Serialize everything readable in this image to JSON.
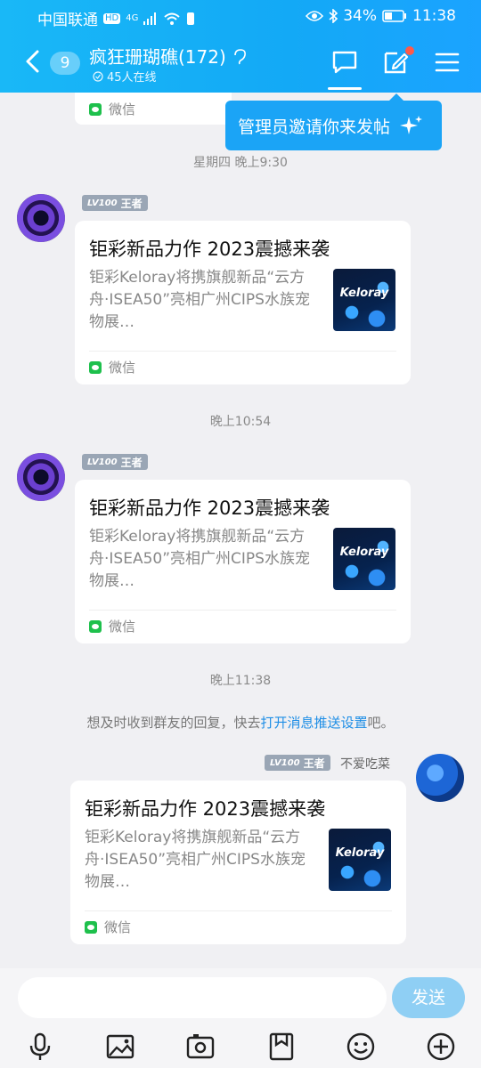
{
  "status_bar": {
    "carrier": "中国联通",
    "hd": "HD",
    "network": "4G",
    "battery_percent": "34%",
    "time": "11:38"
  },
  "header": {
    "unread_count": "9",
    "group_name": "疯狂珊瑚礁(172)",
    "online_text": "45人在线"
  },
  "tooltip": {
    "text": "管理员邀请你来发帖"
  },
  "colors": {
    "header": "#13a9f6",
    "send_button": "#8fcff4",
    "link": "#1e8ee6",
    "level_badge": "#9aa6b5"
  },
  "messages": [
    {
      "type": "partial_card",
      "source": "微信"
    },
    {
      "timestamp": "星期四 晚上9:30"
    },
    {
      "level_prefix": "LV100",
      "level_title": "王者",
      "card": {
        "title": "钜彩新品力作 2023震撼来袭",
        "description": "钜彩Keloray将携旗舰新品“云方舟·ISEA50”亮相广州CIPS水族宠物展…",
        "thumbnail_text": "Keloray",
        "source": "微信"
      }
    },
    {
      "timestamp": "晚上10:54"
    },
    {
      "level_prefix": "LV100",
      "level_title": "王者",
      "card": {
        "title": "钜彩新品力作 2023震撼来袭",
        "description": "钜彩Keloray将携旗舰新品“云方舟·ISEA50”亮相广州CIPS水族宠物展…",
        "thumbnail_text": "Keloray",
        "source": "微信"
      }
    },
    {
      "timestamp": "晚上11:38"
    },
    {
      "notice_prefix": "想及时收到群友的回复，快去",
      "notice_link": "打开消息推送设置",
      "notice_suffix": "吧。"
    },
    {
      "self": true,
      "level_prefix": "LV100",
      "level_title": "王者",
      "sender_name": "不爱吃菜",
      "card": {
        "title": "钜彩新品力作 2023震撼来袭",
        "description": "钜彩Keloray将携旗舰新品“云方舟·ISEA50”亮相广州CIPS水族宠物展…",
        "thumbnail_text": "Keloray",
        "source": "微信"
      }
    }
  ],
  "composer": {
    "send_label": "发送",
    "tools": [
      "microphone-icon",
      "image-icon",
      "camera-icon",
      "bookmark-icon",
      "emoji-icon",
      "plus-icon"
    ]
  }
}
